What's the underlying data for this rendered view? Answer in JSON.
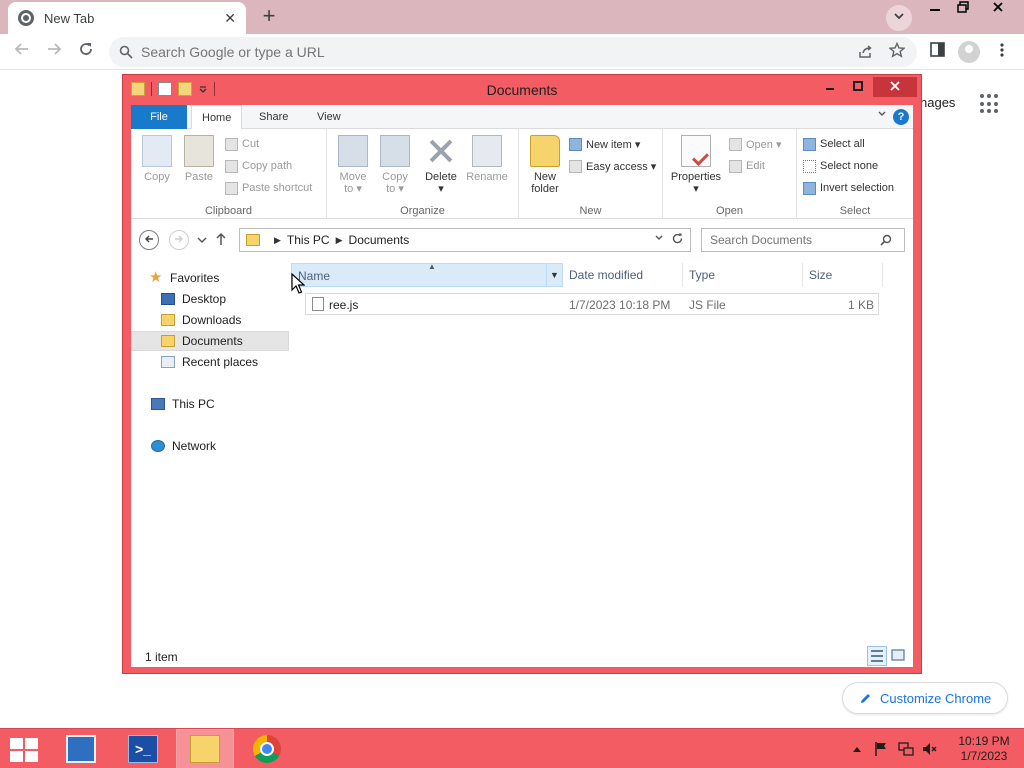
{
  "browser": {
    "tab_title": "New Tab",
    "tab_close": "✕",
    "new_tab": "+",
    "omnibox_placeholder": "Search Google or type a URL",
    "behind_text": "nages",
    "customize_label": "Customize Chrome"
  },
  "explorer": {
    "title": "Documents",
    "tabs": [
      "File",
      "Home",
      "Share",
      "View"
    ],
    "ribbon": {
      "clipboard": {
        "label": "Clipboard",
        "copy": "Copy",
        "paste": "Paste",
        "cut": "Cut",
        "copy_path": "Copy path",
        "paste_shortcut": "Paste shortcut"
      },
      "organize": {
        "label": "Organize",
        "move_to": "Move",
        "move_to_2": "to ▾",
        "copy_to": "Copy",
        "copy_to_2": "to ▾",
        "delete": "Delete",
        "delete_2": "▾",
        "rename": "Rename"
      },
      "new": {
        "label": "New",
        "new_folder": "New",
        "new_folder_2": "folder",
        "new_item": "New item ▾",
        "easy_access": "Easy access ▾"
      },
      "open": {
        "label": "Open",
        "properties": "Properties",
        "properties_2": "▾",
        "open": "Open ▾",
        "edit": "Edit"
      },
      "select": {
        "label": "Select",
        "select_all": "Select all",
        "select_none": "Select none",
        "invert_selection": "Invert selection"
      }
    },
    "address": {
      "crumbs": [
        "This PC",
        "Documents"
      ],
      "search_placeholder": "Search Documents"
    },
    "nav": {
      "favorites": "Favorites",
      "desktop": "Desktop",
      "downloads": "Downloads",
      "documents": "Documents",
      "recent_places": "Recent places",
      "this_pc": "This PC",
      "network": "Network"
    },
    "columns": {
      "name": "Name",
      "date_modified": "Date modified",
      "type": "Type",
      "size": "Size"
    },
    "files": [
      {
        "name": "ree.js",
        "date_modified": "1/7/2023 10:18 PM",
        "type": "JS File",
        "size": "1 KB"
      }
    ],
    "status": "1 item"
  },
  "taskbar": {
    "time": "10:19 PM",
    "date": "1/7/2023"
  },
  "colors": {
    "accent_window": "#f25c62",
    "file_tab": "#1979ca",
    "chrome_tabbar": "#dbb7bd"
  }
}
